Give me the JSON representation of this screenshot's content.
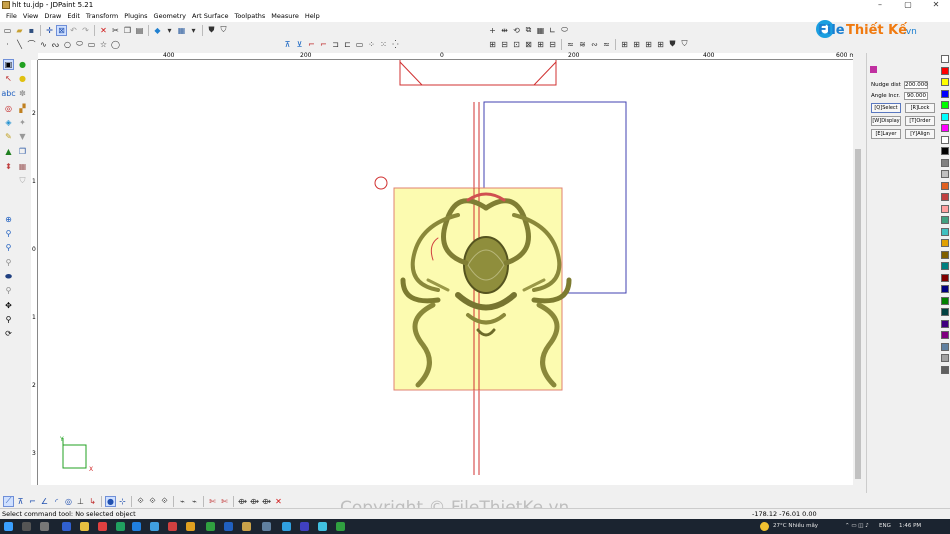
{
  "window": {
    "title": "hlt tu.jdp - JDPaint 5.21",
    "min": "–",
    "max": "▢",
    "close": "✕"
  },
  "menu": [
    "File",
    "View",
    "Draw",
    "Edit",
    "Transform",
    "Plugins",
    "Geometry",
    "Art Surface",
    "Toolpaths",
    "Measure",
    "Help"
  ],
  "ruler": {
    "unit": "600 mm",
    "top_labels": [
      "400",
      "200",
      "0",
      "200",
      "400"
    ],
    "left_labels": [
      "2",
      "1",
      "0",
      "1",
      "2",
      "3"
    ]
  },
  "panel": {
    "nudge_dist_label": "Nudge dist",
    "nudge_dist_value": "200.000",
    "angle_incr_label": "Angle Incr.",
    "angle_incr_value": "90.000",
    "buttons": [
      {
        "label": "[Q]Select"
      },
      {
        "label": "[R]Lock"
      },
      {
        "label": "[W]Display"
      },
      {
        "label": "[T]Order"
      },
      {
        "label": "[E]Layer"
      },
      {
        "label": "[Y]Align"
      }
    ]
  },
  "palette": [
    "#ffffff",
    "#ff0000",
    "#ffff00",
    "#0000ff",
    "#00ff00",
    "#00ffff",
    "#ff00ff",
    "#ffffff",
    "#000000",
    "#808080",
    "#c0c0c0",
    "#e06020",
    "#c04040",
    "#ffa0a0",
    "#40a080",
    "#40c0c0",
    "#e0a000",
    "#806000",
    "#008080",
    "#800000",
    "#000080",
    "#008000",
    "#004040",
    "#400080",
    "#800080",
    "#6080a0",
    "#a0a0a0",
    "#606060"
  ],
  "status": {
    "message": "Select command tool: No selected object",
    "coords": "-178.12 -76.01 0.00"
  },
  "taskbar": {
    "weather": "27°C  Nhiều mây",
    "lang": "ENG",
    "time": "1:46 PM"
  },
  "watermark": "Copyright © FileThietKe.vn",
  "logo": {
    "text_main": "File",
    "text_accent": "Thiết Kế",
    "text_suffix": ".vn"
  },
  "axis": {
    "x": "X",
    "y": "Y"
  }
}
